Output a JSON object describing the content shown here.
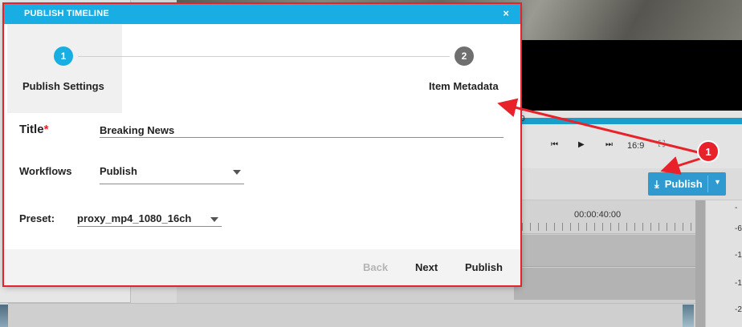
{
  "dialog": {
    "title": "PUBLISH TIMELINE",
    "close_glyph": "×",
    "steps": [
      {
        "number": "1",
        "label": "Publish Settings",
        "state": "active"
      },
      {
        "number": "2",
        "label": "Item Metadata",
        "state": "inactive"
      }
    ],
    "form": {
      "title_label": "Title",
      "title_required_mark": "*",
      "title_value": "Breaking News",
      "workflows_label": "Workflows",
      "workflows_value": "Publish",
      "preset_label": "Preset:",
      "preset_value": "proxy_mp4_1080_16ch"
    },
    "footer": {
      "back_label": "Back",
      "next_label": "Next",
      "publish_label": "Publish"
    }
  },
  "background": {
    "scrub_start_glyph": "0",
    "controls": [
      "⏮",
      "▶",
      "⏭"
    ],
    "aspect_ratio": "16:9",
    "expand_glyph": "⛶",
    "publish_button_label": "Publish",
    "ruler_timecode": "00:00:40:00",
    "meter_labels": [
      "-",
      "-6",
      "-1",
      "-1",
      "-2"
    ]
  },
  "annotation": {
    "badge_number": "1"
  },
  "colors": {
    "accent": "#18aee3",
    "annotation_red": "#e8222a",
    "step_inactive": "#6f6f6f",
    "bg_publish_button": "#2f9ad0"
  },
  "icons": {
    "close": "close-icon",
    "download": "download-icon",
    "dropdown": "chevron-down-icon"
  }
}
